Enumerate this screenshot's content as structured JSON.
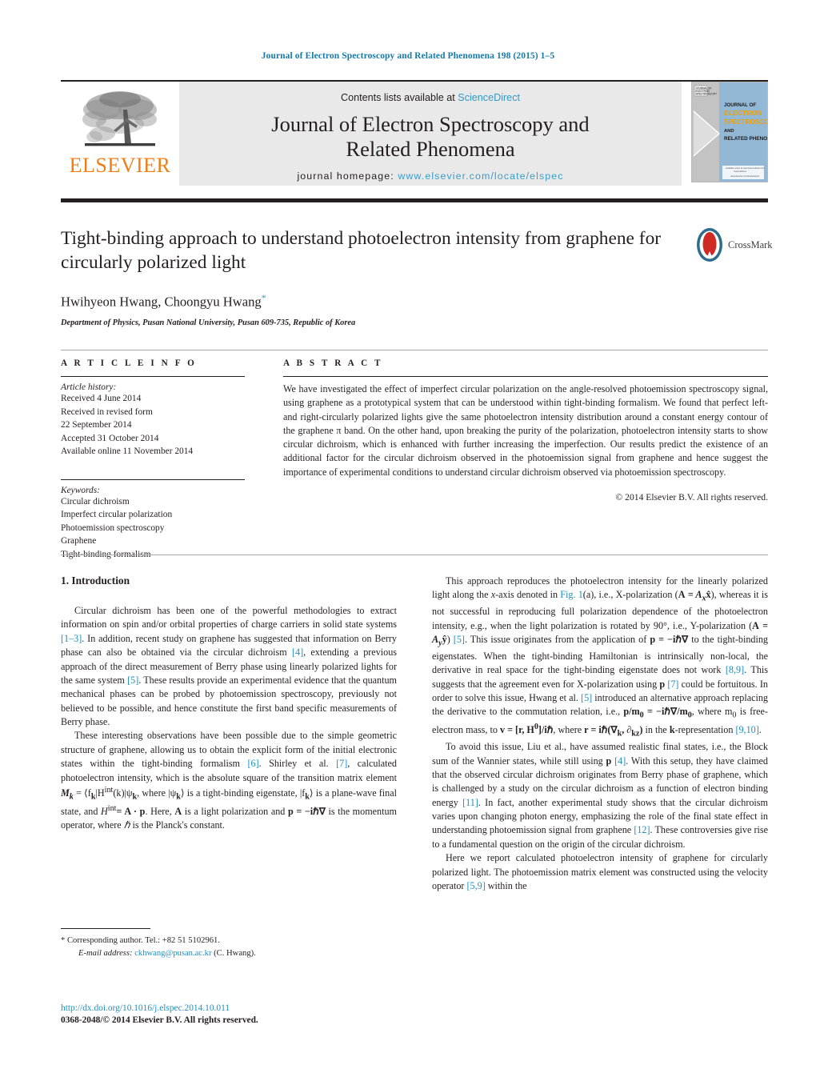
{
  "running_head": "Journal of Electron Spectroscopy and Related Phenomena 198 (2015) 1–5",
  "masthead": {
    "publisher_name": "ELSEVIER",
    "contents_prefix": "Contents lists available at ",
    "contents_link": "ScienceDirect",
    "journal_title_line1": "Journal of Electron Spectroscopy and",
    "journal_title_line2": "Related Phenomena",
    "homepage_prefix": "journal homepage: ",
    "homepage_url": "www.elsevier.com/locate/elspec",
    "cover": {
      "line1": "JOURNAL OF",
      "line2": "ELECTRON",
      "line3": "SPECTROSCOPY",
      "line4": "AND",
      "line5": "RELATED PHENOMENA"
    },
    "accent_link_color": "#2f9cc7",
    "elsevier_orange": "#F07E13"
  },
  "title": "Tight-binding approach to understand photoelectron intensity from graphene for circularly polarized light",
  "crossmark_label": "CrossMark",
  "authors": "Hwihyeon Hwang, Choongyu Hwang",
  "author_marker": "*",
  "affiliation": "Department of Physics, Pusan National University, Pusan 609-735, Republic of Korea",
  "article_info": {
    "heading": "A R T I C L E   I N F O",
    "history_label": "Article history:",
    "history": [
      "Received 4 June 2014",
      "Received in revised form",
      "22 September 2014",
      "Accepted 31 October 2014",
      "Available online 11 November 2014"
    ],
    "keywords_label": "Keywords:",
    "keywords": [
      "Circular dichroism",
      "Imperfect circular polarization",
      "Photoemission spectroscopy",
      "Graphene",
      "Tight-binding formalism"
    ]
  },
  "abstract": {
    "heading": "A B S T R A C T",
    "body": "We have investigated the effect of imperfect circular polarization on the angle-resolved photoemission spectroscopy signal, using graphene as a prototypical system that can be understood within tight-binding formalism. We found that perfect left- and right-circularly polarized lights give the same photoelectron intensity distribution around a constant energy contour of the graphene π band. On the other hand, upon breaking the purity of the polarization, photoelectron intensity starts to show circular dichroism, which is enhanced with further increasing the imperfection. Our results predict the existence of an additional factor for the circular dichroism observed in the photoemission signal from graphene and hence suggest the importance of experimental conditions to understand circular dichroism observed via photoemission spectroscopy.",
    "copyright": "© 2014 Elsevier B.V. All rights reserved."
  },
  "section": {
    "number_title": "1.  Introduction"
  },
  "left_column_paragraphs": {
    "p1_a": "Circular dichroism has been one of the powerful methodologies to extract information on spin and/or orbital properties of charge carriers in solid state systems ",
    "p1_r1": "[1–3]",
    "p1_b": ". In addition, recent study on graphene has suggested that information on Berry phase can also be obtained via the circular dichroism ",
    "p1_r2": "[4]",
    "p1_c": ", extending a previous approach of the direct measurement of Berry phase using linearly polarized lights for the same system ",
    "p1_r3": "[5]",
    "p1_d": ". These results provide an experimental evidence that the quantum mechanical phases can be probed by photoemission spectroscopy, previously not believed to be possible, and hence constitute the first band specific measurements of Berry phase.",
    "p2_a": "These interesting observations have been possible due to the simple geometric structure of graphene, allowing us to obtain the explicit form of the initial electronic states within the tight-binding formalism ",
    "p2_r1": "[6]",
    "p2_b": ". Shirley et al. ",
    "p2_r2": "[7]",
    "p2_c": ", calculated photoelectron intensity, which is the absolute square of the transition matrix element ",
    "p2_math1": "M",
    "p2_math1_sub": "k",
    "p2_math2": " = ⟨f",
    "p2_d": ", where |ψ",
    "p2_e": "⟩ is a tight-binding eigenstate, |f",
    "p2_f": "⟩ is a plane-wave final state, and ",
    "p2_g": ". Here, ",
    "p2_h": " is a light polarization and ",
    "p2_i": " is the momentum operator, where ",
    "p2_j": " is the Planck's constant.",
    "formula_Mk": "M",
    "formula_mid": "|H",
    "formula_int": "int",
    "formula_k": "(k)|ψ",
    "formula_Hint": "H",
    "formula_Ap": "= A · p",
    "formula_p": "p = −iℏ∇",
    "formula_hbar": "ℏ"
  },
  "right_column_paragraphs": {
    "p3_a": "This approach reproduces the photoelectron intensity for the linearly polarized light along the ",
    "p3_xaxis": "x",
    "p3_b": "-axis denoted in ",
    "p3_figref": "Fig. 1",
    "p3_c": "(a), i.e., X-polarization (",
    "p3_polx": "A = A",
    "p3_polx_sub": "x",
    "p3_polx_vec": "x̂",
    "p3_d": "), whereas it is not successful in reproducing full polarization dependence of the photoelectron intensity, e.g., when the light polarization is rotated by 90°, i.e., Y-polarization (",
    "p3_poly": "A = A",
    "p3_poly_sub": "y",
    "p3_poly_vec": "ŷ",
    "p3_e": ") ",
    "p3_r1": "[5]",
    "p3_f": ". This issue originates from the application of ",
    "p3_pop": "p = −iℏ∇",
    "p3_g": " to the tight-binding eigenstates. When the tight-binding Hamiltonian is intrinsically non-local, the derivative in real space for the tight-binding eigenstate does not work ",
    "p3_r2": "[8,9]",
    "p3_h": ". This suggests that the agreement even for X-polarization using ",
    "p3_pbold": "p",
    "p3_r3": "[7]",
    "p3_i": " could be fortuitous. In order to solve this issue, Hwang et al. ",
    "p3_r4": "[5]",
    "p3_j": " introduced an alternative approach replacing the derivative to the commutation relation, i.e., ",
    "p3_eq1": "p/m",
    "p3_eq1_sub": "0",
    "p3_eq1_b": " = −iℏ∇/m",
    "p3_eq1_c": ", where m",
    "p3_eq1_d": " is free-electron mass, to ",
    "p3_eq2": "v = [r, H",
    "p3_eq2_sup": "0",
    "p3_eq2_b": "]/iℏ",
    "p3_k": ", where ",
    "p3_eq3": "r = iℏ(∇",
    "p3_eq3_sub": "k",
    "p3_eq3_b": ", ∂",
    "p3_eq3_sub2": "kz",
    "p3_eq3_c": ")",
    "p3_l": " in the ",
    "p3_krep": "k",
    "p3_m": "-representation ",
    "p3_r5": "[9,10]",
    "p3_n": ".",
    "p4_a": "To avoid this issue, Liu et al., have assumed realistic final states, i.e., the Block sum of the Wannier states, while still using ",
    "p4_pbold": "p",
    "p4_r1": "[4]",
    "p4_b": ". With this setup, they have claimed that the observed circular dichroism originates from Berry phase of graphene, which is challenged by a study on the circular dichroism as a function of electron binding energy ",
    "p4_r2": "[11]",
    "p4_c": ". In fact, another experimental study shows that the circular dichroism varies upon changing photon energy, emphasizing the role of the final state effect in understanding photoemission signal from graphene ",
    "p4_r3": "[12]",
    "p4_d": ". These controversies give rise to a fundamental question on the origin of the circular dichroism.",
    "p5_a": "Here we report calculated photoelectron intensity of graphene for circularly polarized light. The photoemission matrix element was constructed using the velocity operator ",
    "p5_r1": "[5,9]",
    "p5_b": " within the"
  },
  "footnotes": {
    "corresponding_marker": "*",
    "corresponding": "Corresponding author. Tel.: +82 51 5102961.",
    "email_label": "E-mail address:",
    "email": "ckhwang@pusan.ac.kr",
    "email_suffix": "(C. Hwang)."
  },
  "doi": "http://dx.doi.org/10.1016/j.elspec.2014.10.011",
  "issn_line": "0368-2048/© 2014 Elsevier B.V. All rights reserved."
}
